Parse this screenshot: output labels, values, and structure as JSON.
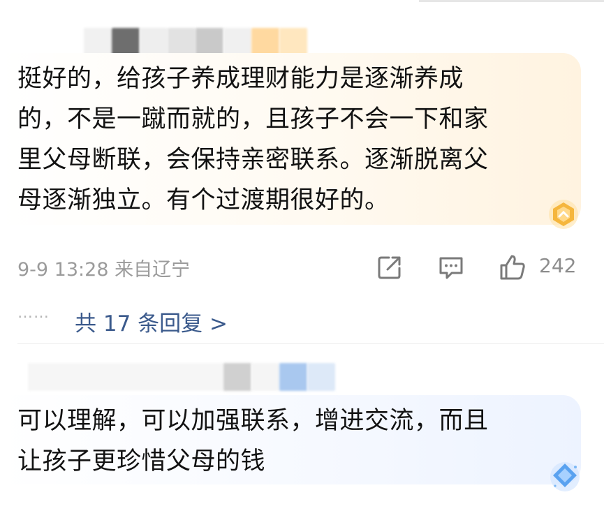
{
  "comments": [
    {
      "text_lines": [
        "挺好的，给孩子养成理财能力是逐渐养成",
        "的，不是一蹴而就的，且孩子不会一下和家",
        "里父母断联，会保持亲密联系。逐渐脱离父",
        "母逐渐独立。有个过渡期很好的。"
      ],
      "meta": "9-9 13:28 来自辽宁",
      "like_count": "242",
      "replies_link": "共 17 条回复 >",
      "badge_color": "#f5b63d"
    },
    {
      "text_lines": [
        "可以理解，可以加强联系，增进交流，而且",
        "让孩子更珍惜父母的钱"
      ],
      "badge_color": "#5aa2f0"
    }
  ],
  "icons": {
    "share": "share-icon",
    "comment": "comment-icon",
    "like": "thumbs-up-icon",
    "badge": "badge-icon"
  },
  "colors": {
    "link": "#3b5a8c",
    "meta": "#9b9b9b",
    "text": "#121212"
  },
  "dots": "……"
}
